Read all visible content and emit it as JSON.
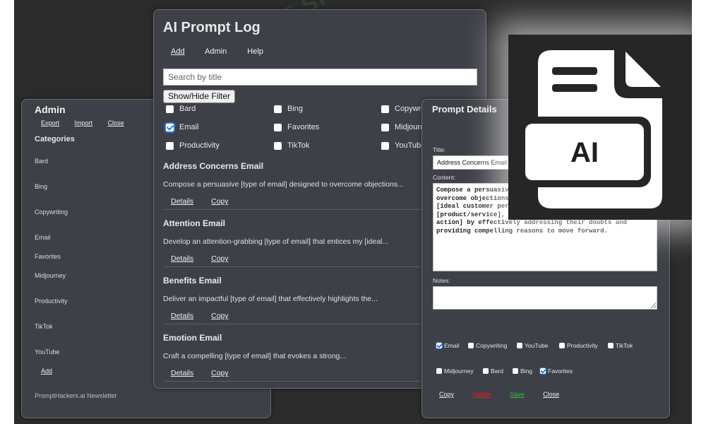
{
  "admin": {
    "title": "Admin",
    "menu": [
      "Export",
      "Import",
      "Close"
    ],
    "categories_title": "Categories",
    "categories": [
      "Bard",
      "Bing",
      "Copywriting",
      "Email",
      "Favorites",
      "Midjourney",
      "Productivity",
      "TikTok",
      "YouTube"
    ],
    "add_label": "Add",
    "footer": "PromptHackers.ai Newsletter"
  },
  "log": {
    "title": "AI Prompt Log",
    "nav": [
      "Add",
      "Admin",
      "Help"
    ],
    "search_placeholder": "Search by title",
    "filter_button": "Show/Hide Filter",
    "filters": [
      {
        "label": "Bard",
        "checked": false
      },
      {
        "label": "Bing",
        "checked": false
      },
      {
        "label": "Copywriting",
        "checked": false
      },
      {
        "label": "Email",
        "checked": true
      },
      {
        "label": "Favorites",
        "checked": false
      },
      {
        "label": "Midjourney",
        "checked": false
      },
      {
        "label": "Productivity",
        "checked": false
      },
      {
        "label": "TikTok",
        "checked": false
      },
      {
        "label": "YouTube",
        "checked": false
      }
    ],
    "entries": [
      {
        "title": "Address Concerns Email",
        "desc": "Compose a persuasive [type of email] designed to overcome objections..."
      },
      {
        "title": "Attention Email",
        "desc": "Develop an attention-grabbing [type of email] that entices my [ideal..."
      },
      {
        "title": "Benefits Email",
        "desc": "Deliver an impactful [type of email] that effectively highlights the..."
      },
      {
        "title": "Emotion Email",
        "desc": "Craft a compelling [type of email] that evokes a strong..."
      }
    ],
    "details_label": "Details",
    "copy_label": "Copy"
  },
  "details": {
    "title": "Prompt Details",
    "title_label": "Title:",
    "title_value": "Address Concerns Email",
    "content_label": "Content:",
    "content_value": "Compose a persuasive [type of email] designed to\novercome objections and concerns my\n[ideal customer persona] may have about\n[product/service], leading them to [desired\naction] by effectively addressing their doubts and\nproviding compelling reasons to move forward.",
    "notes_label": "Notes:",
    "tags": [
      {
        "label": "Email",
        "checked": true
      },
      {
        "label": "Copywriting",
        "checked": false
      },
      {
        "label": "YouTube",
        "checked": false
      },
      {
        "label": "Productivity",
        "checked": false
      },
      {
        "label": "TikTok",
        "checked": false
      },
      {
        "label": "Midjourney",
        "checked": false
      },
      {
        "label": "Bard",
        "checked": false
      },
      {
        "label": "Bing",
        "checked": false
      },
      {
        "label": "Favorites",
        "checked": true
      }
    ],
    "actions": {
      "copy": "Copy",
      "delete": "Delete",
      "save": "Save",
      "close": "Close"
    },
    "delete_color": "#e02020",
    "save_color": "#2fbf3a"
  },
  "icon": {
    "name": "ai-file-icon",
    "text": "AI"
  },
  "watermark": "AI TALENT SPACE"
}
